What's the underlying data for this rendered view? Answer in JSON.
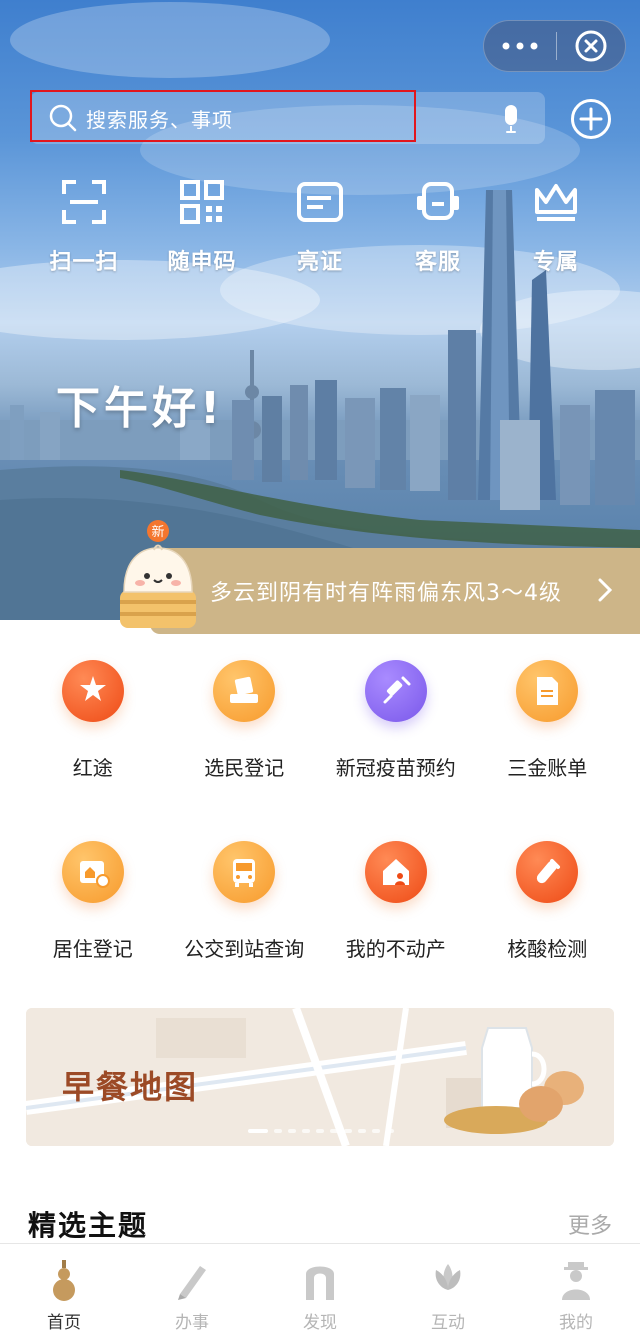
{
  "header": {
    "search_placeholder": "搜索服务、事项"
  },
  "quick_actions": [
    {
      "label": "扫一扫",
      "icon": "scan-icon"
    },
    {
      "label": "随申码",
      "icon": "qr-code-icon"
    },
    {
      "label": "亮证",
      "icon": "card-icon"
    },
    {
      "label": "客服",
      "icon": "headset-icon"
    },
    {
      "label": "专属",
      "icon": "crown-icon"
    }
  ],
  "greeting": "下午好!",
  "weather": {
    "badge": "新",
    "text": "多云到阴有时有阵雨偏东风3～4级"
  },
  "services": [
    {
      "label": "红途",
      "icon": "star-road-icon",
      "color": "#f3541f"
    },
    {
      "label": "选民登记",
      "icon": "ballot-icon",
      "color": "#f9a43b"
    },
    {
      "label": "新冠疫苗预约",
      "icon": "syringe-icon",
      "color": "#8a6cf0"
    },
    {
      "label": "三金账单",
      "icon": "bill-icon",
      "color": "#f9a43b"
    },
    {
      "label": "居住登记",
      "icon": "residence-icon",
      "color": "#f9a43b"
    },
    {
      "label": "公交到站查询",
      "icon": "bus-icon",
      "color": "#f9a43b"
    },
    {
      "label": "我的不动产",
      "icon": "house-icon",
      "color": "#f3541f"
    },
    {
      "label": "核酸检测",
      "icon": "test-tube-icon",
      "color": "#f3541f"
    }
  ],
  "banner": {
    "title": "早餐地图"
  },
  "section": {
    "title": "精选主题",
    "more": "更多"
  },
  "tabs": [
    {
      "label": "首页",
      "icon": "gourd-icon"
    },
    {
      "label": "办事",
      "icon": "pen-icon"
    },
    {
      "label": "发现",
      "icon": "arch-icon"
    },
    {
      "label": "互动",
      "icon": "magnolia-icon"
    },
    {
      "label": "我的",
      "icon": "person-icon"
    }
  ]
}
